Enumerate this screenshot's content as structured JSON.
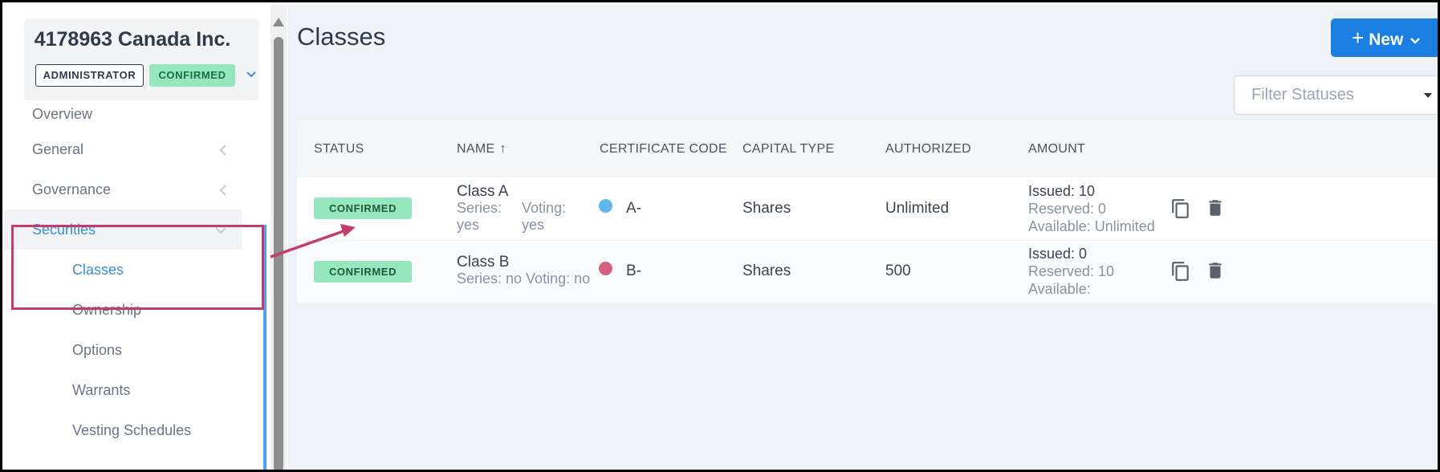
{
  "company": {
    "name": "4178963 Canada Inc.",
    "role_badge": "ADMINISTRATOR",
    "status_badge": "CONFIRMED"
  },
  "sidebar": {
    "items": [
      {
        "label": "Overview",
        "icon": "none"
      },
      {
        "label": "General",
        "icon": "chevron-left-icon"
      },
      {
        "label": "Governance",
        "icon": "chevron-left-icon"
      },
      {
        "label": "Securities",
        "icon": "chevron-down-icon"
      },
      {
        "label": "Classes"
      },
      {
        "label": "Ownership"
      },
      {
        "label": "Options"
      },
      {
        "label": "Warrants"
      },
      {
        "label": "Vesting Schedules"
      }
    ]
  },
  "main": {
    "title": "Classes",
    "new_button": "New",
    "filter_placeholder": "Filter Statuses"
  },
  "table": {
    "headers": [
      "STATUS",
      "NAME",
      "CERTIFICATE CODE",
      "CAPITAL TYPE",
      "AUTHORIZED",
      "AMOUNT"
    ],
    "rows": [
      {
        "status": "CONFIRMED",
        "name": "Class A",
        "series_label": "Series:",
        "series_value": "yes",
        "voting_label": "Voting:",
        "voting_value": "yes",
        "dot_color": "#5fb7ec",
        "code": "A-",
        "capital_type": "Shares",
        "authorized": "Unlimited",
        "issued": "Issued: 10",
        "reserved": "Reserved: 0",
        "available": "Available: Unlimited"
      },
      {
        "status": "CONFIRMED",
        "name": "Class B",
        "series_line": "Series: no Voting: no",
        "dot_color": "#d4607f",
        "code": "B-",
        "capital_type": "Shares",
        "authorized": "500",
        "issued": "Issued: 0",
        "reserved": "Reserved: 10",
        "available": "Available:"
      }
    ]
  },
  "colors": {
    "accent": "#1a7fe0",
    "confirmed_bg": "#96e6be",
    "highlight": "#c43c6d"
  }
}
